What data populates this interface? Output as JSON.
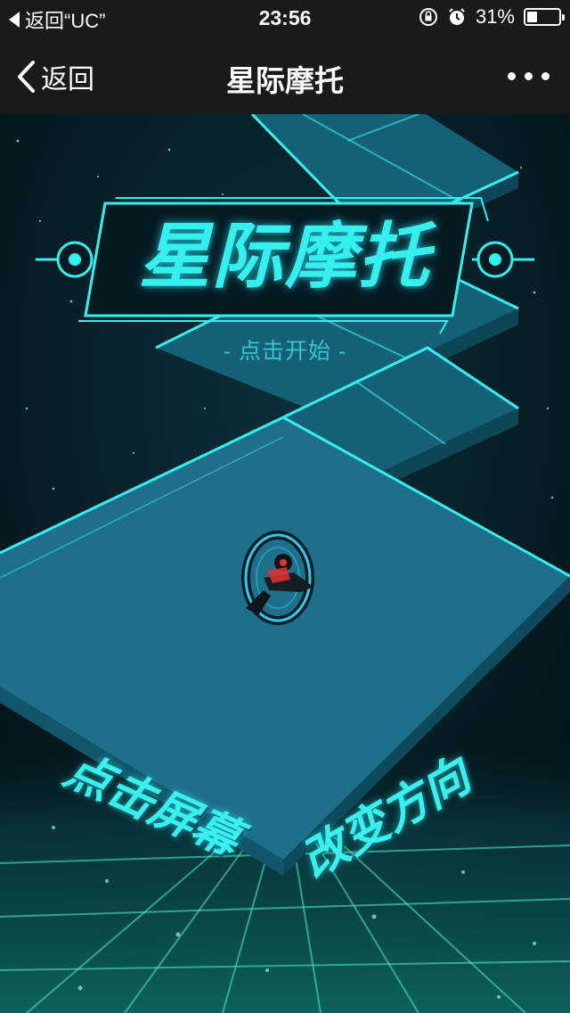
{
  "status_bar": {
    "back_app_label": "返回“UC”",
    "time": "23:56",
    "battery_percent": "31%",
    "battery_level": 0.31,
    "icons": [
      "orientation-lock-icon",
      "alarm-icon",
      "battery-icon"
    ]
  },
  "nav": {
    "back_label": "返回",
    "title": "星际摩托",
    "more_icon": "more-dots-icon"
  },
  "game": {
    "logo_text": "星际摩托",
    "subtitle": "- 点击开始 -",
    "hint_left": "点击屏幕",
    "hint_right": "改变方向",
    "colors": {
      "accent": "#35f0ee",
      "platform": "#1e6f8a",
      "background": "#05161c"
    }
  }
}
